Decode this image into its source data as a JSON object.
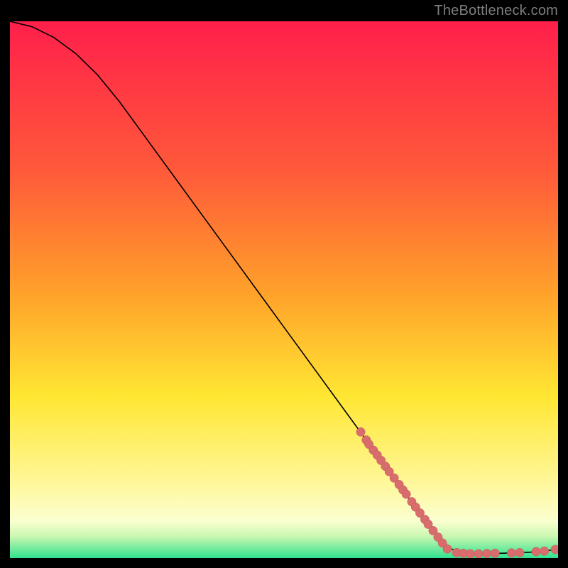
{
  "watermark": "TheBottleneck.com",
  "colors": {
    "gradient_top": "#ff1f4b",
    "gradient_mid1": "#ff8d2a",
    "gradient_mid2": "#ffe733",
    "gradient_mid3": "#fffcc0",
    "gradient_bottom": "#2fe28f",
    "curve": "#000000",
    "dot": "#d96d6d"
  },
  "chart_data": {
    "type": "line",
    "title": "",
    "xlabel": "",
    "ylabel": "",
    "xlim": [
      0,
      100
    ],
    "ylim": [
      0,
      100
    ],
    "curve": [
      {
        "x": 0,
        "y": 100
      },
      {
        "x": 4,
        "y": 99
      },
      {
        "x": 8,
        "y": 97
      },
      {
        "x": 12,
        "y": 94
      },
      {
        "x": 16,
        "y": 90
      },
      {
        "x": 20,
        "y": 85
      },
      {
        "x": 25,
        "y": 78
      },
      {
        "x": 30,
        "y": 71
      },
      {
        "x": 35,
        "y": 64
      },
      {
        "x": 40,
        "y": 57
      },
      {
        "x": 45,
        "y": 50
      },
      {
        "x": 50,
        "y": 43
      },
      {
        "x": 55,
        "y": 36
      },
      {
        "x": 60,
        "y": 29
      },
      {
        "x": 65,
        "y": 22
      },
      {
        "x": 70,
        "y": 15
      },
      {
        "x": 75,
        "y": 8
      },
      {
        "x": 80,
        "y": 2
      },
      {
        "x": 82,
        "y": 1
      },
      {
        "x": 85,
        "y": 0.8
      },
      {
        "x": 90,
        "y": 0.9
      },
      {
        "x": 95,
        "y": 1.1
      },
      {
        "x": 100,
        "y": 1.6
      }
    ],
    "scatter": [
      {
        "x": 64,
        "y": 23.5
      },
      {
        "x": 65,
        "y": 22
      },
      {
        "x": 65.5,
        "y": 21.2
      },
      {
        "x": 66.3,
        "y": 20.1
      },
      {
        "x": 67,
        "y": 19.2
      },
      {
        "x": 67.7,
        "y": 18.2
      },
      {
        "x": 68.5,
        "y": 17.1
      },
      {
        "x": 69.2,
        "y": 16.1
      },
      {
        "x": 70.1,
        "y": 14.9
      },
      {
        "x": 71,
        "y": 13.7
      },
      {
        "x": 71.7,
        "y": 12.7
      },
      {
        "x": 72.3,
        "y": 11.9
      },
      {
        "x": 73.3,
        "y": 10.5
      },
      {
        "x": 74,
        "y": 9.5
      },
      {
        "x": 74.8,
        "y": 8.4
      },
      {
        "x": 75.7,
        "y": 7.2
      },
      {
        "x": 76.3,
        "y": 6.3
      },
      {
        "x": 77.2,
        "y": 5.1
      },
      {
        "x": 78.1,
        "y": 3.9
      },
      {
        "x": 78.9,
        "y": 2.8
      },
      {
        "x": 79.8,
        "y": 1.7
      },
      {
        "x": 81.5,
        "y": 1.0
      },
      {
        "x": 82.7,
        "y": 0.9
      },
      {
        "x": 84.0,
        "y": 0.8
      },
      {
        "x": 85.5,
        "y": 0.8
      },
      {
        "x": 87.0,
        "y": 0.85
      },
      {
        "x": 88.5,
        "y": 0.9
      },
      {
        "x": 91.5,
        "y": 0.95
      },
      {
        "x": 93.0,
        "y": 1.0
      },
      {
        "x": 96.0,
        "y": 1.2
      },
      {
        "x": 97.5,
        "y": 1.3
      },
      {
        "x": 99.5,
        "y": 1.6
      }
    ]
  }
}
